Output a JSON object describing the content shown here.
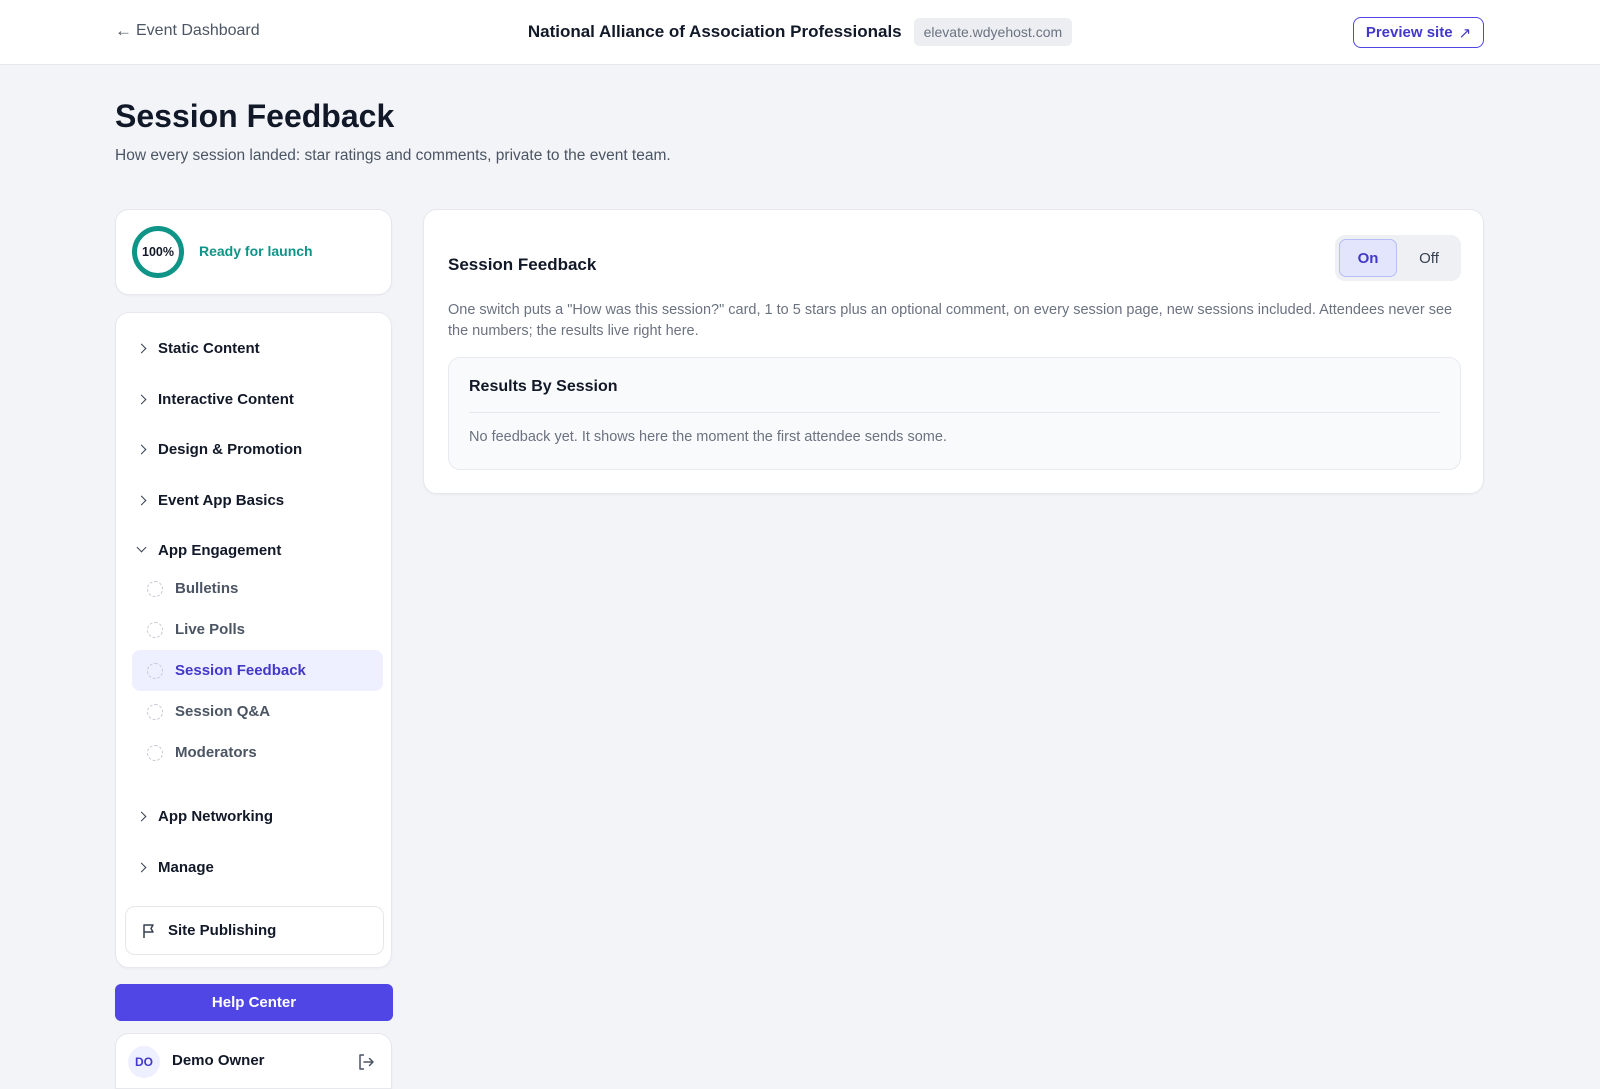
{
  "topbar": {
    "back_label": "Event Dashboard",
    "back_arrow": "←",
    "org_name": "National Alliance of Association Professionals",
    "domain": "elevate.wdyehost.com",
    "preview_label": "Preview site",
    "preview_icon": "↗"
  },
  "header": {
    "title": "Session Feedback",
    "subtitle": "How every session landed: star ratings and comments, private to the event team."
  },
  "sidebar": {
    "progress_percent": "100%",
    "progress_value": 1.0,
    "status": "Ready for launch",
    "sections": [
      {
        "label": "Static Content",
        "expanded": false
      },
      {
        "label": "Interactive Content",
        "expanded": false
      },
      {
        "label": "Design & Promotion",
        "expanded": false
      },
      {
        "label": "Event App Basics",
        "expanded": false
      },
      {
        "label": "App Engagement",
        "expanded": true
      },
      {
        "label": "App Networking",
        "expanded": false
      },
      {
        "label": "Manage",
        "expanded": false
      }
    ],
    "engagement_items": [
      {
        "label": "Bulletins",
        "active": false
      },
      {
        "label": "Live Polls",
        "active": false
      },
      {
        "label": "Session Feedback",
        "active": true
      },
      {
        "label": "Session Q&A",
        "active": false
      },
      {
        "label": "Moderators",
        "active": false
      }
    ],
    "publishing_label": "Site Publishing",
    "help_label": "Help Center",
    "user": {
      "initials": "DO",
      "name": "Demo Owner"
    }
  },
  "main": {
    "title": "Session Feedback",
    "toggle": {
      "on_label": "On",
      "off_label": "Off",
      "selected": "On"
    },
    "description": "One switch puts a \"How was this session?\" card, 1 to 5 stars plus an optional comment, on every session page, new sessions included. Attendees never see the numbers; the results live right here.",
    "results": {
      "title": "Results By Session",
      "empty_message": "No feedback yet. It shows here the moment the first attendee sends some."
    }
  },
  "colors": {
    "accent": "#4f46e5",
    "success": "#0f9488",
    "background": "#f3f4f8"
  }
}
